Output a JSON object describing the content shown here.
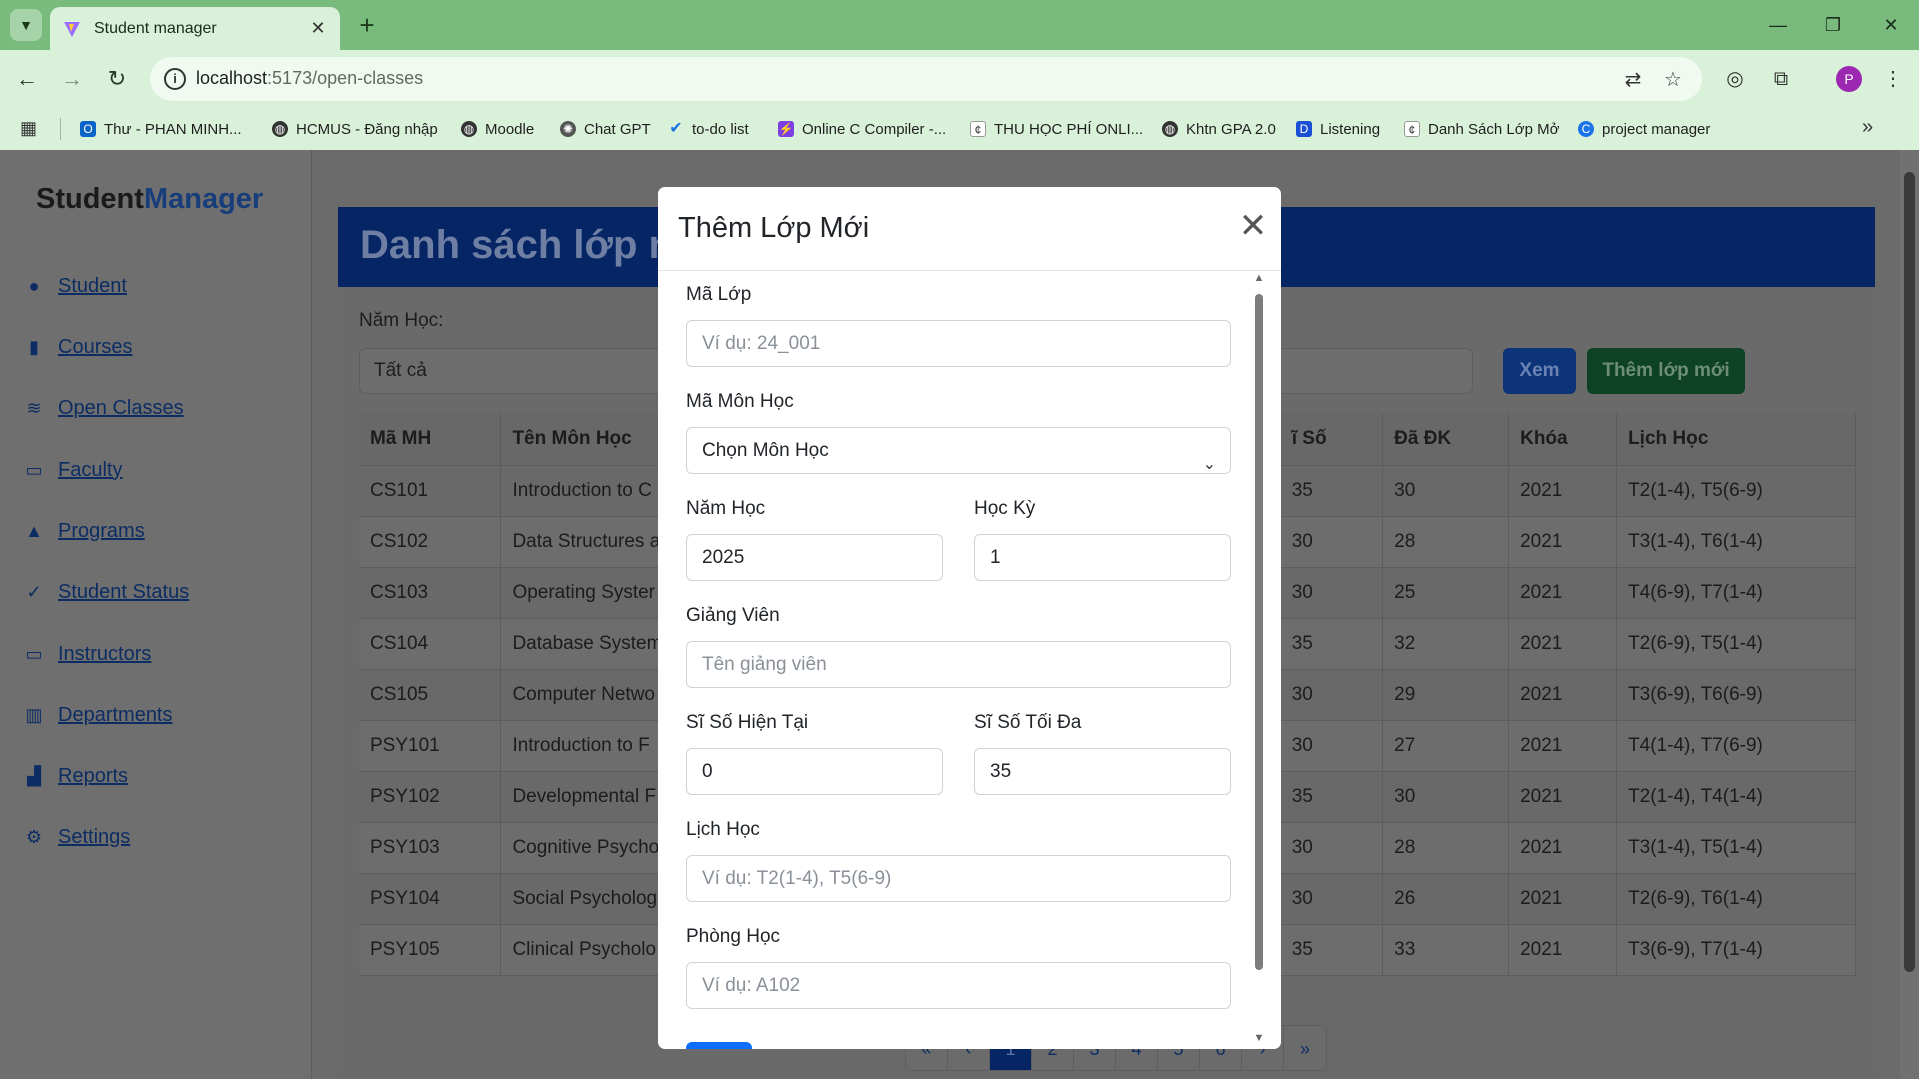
{
  "browser": {
    "tab_title": "Student manager",
    "url_host": "localhost",
    "url_rest": ":5173/open-classes",
    "bookmarks": [
      "Thư - PHAN MINH...",
      "HCMUS - Đăng nhập",
      "Moodle",
      "Chat GPT",
      "to-do list",
      "Online C Compiler -...",
      "THU HỌC PHÍ ONLI...",
      "Khtn GPA 2.0",
      "Listening",
      "Danh Sách Lớp Mở",
      "project manager"
    ],
    "profile_initial": "P"
  },
  "sidebar": {
    "brand_part1": "Student",
    "brand_part2": "Manager",
    "items": [
      {
        "label": "Student"
      },
      {
        "label": "Courses"
      },
      {
        "label": "Open Classes"
      },
      {
        "label": "Faculty"
      },
      {
        "label": "Programs"
      },
      {
        "label": "Student Status"
      },
      {
        "label": "Instructors"
      },
      {
        "label": "Departments"
      },
      {
        "label": "Reports"
      },
      {
        "label": "Settings"
      }
    ]
  },
  "main": {
    "banner_title": "Danh sách lớp m",
    "filter_label": "Năm Học:",
    "filter_value": "Tất cả",
    "view_button": "Xem",
    "add_button": "Thêm lớp mới",
    "columns": [
      "Mã MH",
      "Tên Môn Học",
      "",
      "ĩ Số",
      "Đã ĐK",
      "Khóa",
      "Lịch Học"
    ],
    "rows": [
      [
        "CS101",
        "Introduction to C",
        "",
        "35",
        "30",
        "2021",
        "T2(1-4), T5(6-9)"
      ],
      [
        "CS102",
        "Data Structures a",
        "",
        "30",
        "28",
        "2021",
        "T3(1-4), T6(1-4)"
      ],
      [
        "CS103",
        "Operating Syster",
        "",
        "30",
        "25",
        "2021",
        "T4(6-9), T7(1-4)"
      ],
      [
        "CS104",
        "Database System",
        "",
        "35",
        "32",
        "2021",
        "T2(6-9), T5(1-4)"
      ],
      [
        "CS105",
        "Computer Netwo",
        "",
        "30",
        "29",
        "2021",
        "T3(6-9), T6(6-9)"
      ],
      [
        "PSY101",
        "Introduction to F",
        "",
        "30",
        "27",
        "2021",
        "T4(1-4), T7(6-9)"
      ],
      [
        "PSY102",
        "Developmental F",
        "",
        "35",
        "30",
        "2021",
        "T2(1-4), T4(1-4)"
      ],
      [
        "PSY103",
        "Cognitive Psycho",
        "",
        "30",
        "28",
        "2021",
        "T3(1-4), T5(1-4)"
      ],
      [
        "PSY104",
        "Social Psycholog",
        "",
        "30",
        "26",
        "2021",
        "T2(6-9), T6(1-4)"
      ],
      [
        "PSY105",
        "Clinical Psycholo",
        "",
        "35",
        "33",
        "2021",
        "T3(6-9), T7(1-4)"
      ]
    ],
    "pagination": [
      "«",
      "‹",
      "1",
      "2",
      "3",
      "4",
      "5",
      "6",
      "›",
      "»"
    ],
    "active_page": "1"
  },
  "modal": {
    "title": "Thêm Lớp Mới",
    "close_symbol": "✕",
    "fields": {
      "class_code": {
        "label": "Mã Lớp",
        "placeholder": "Ví dụ: 24_001"
      },
      "course_code": {
        "label": "Mã Môn Học",
        "value": "Chọn Môn Học"
      },
      "year": {
        "label": "Năm Học",
        "value": "2025"
      },
      "semester": {
        "label": "Học Kỳ",
        "value": "1"
      },
      "instructor": {
        "label": "Giảng Viên",
        "placeholder": "Tên giảng viên"
      },
      "current_size": {
        "label": "Sĩ Số Hiện Tại",
        "value": "0"
      },
      "max_size": {
        "label": "Sĩ Số Tối Đa",
        "value": "35"
      },
      "schedule": {
        "label": "Lịch Học",
        "placeholder": "Ví dụ: T2(1-4), T5(6-9)"
      },
      "room": {
        "label": "Phòng Học",
        "placeholder": "Ví dụ: A102"
      }
    }
  },
  "colors": {
    "browser_frame": "#78bb7d",
    "toolbar": "#d9f0d9",
    "banner": "#0a4bc7",
    "primary": "#0d6efd",
    "success": "#198754"
  }
}
